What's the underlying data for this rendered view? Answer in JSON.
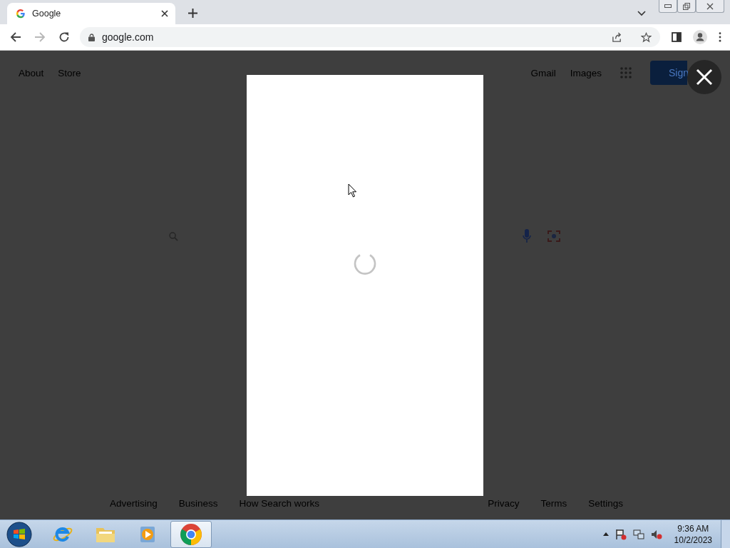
{
  "browser": {
    "tab": {
      "title": "Google",
      "selected": true
    },
    "forward_disabled": true,
    "url": "google.com"
  },
  "page": {
    "header_left": [
      "About",
      "Store"
    ],
    "header_right": [
      "Gmail",
      "Images"
    ],
    "sign_in": "Sign",
    "footer_left": [
      "Advertising",
      "Business",
      "How Search works"
    ],
    "footer_right": [
      "Privacy",
      "Terms",
      "Settings"
    ]
  },
  "taskbar": {
    "apps": [
      {
        "kind": "ie",
        "selected": false
      },
      {
        "kind": "folder",
        "selected": false
      },
      {
        "kind": "media",
        "selected": false
      },
      {
        "kind": "chrome",
        "selected": true
      }
    ],
    "time": "9:36 AM",
    "date": "10/2/2023"
  }
}
